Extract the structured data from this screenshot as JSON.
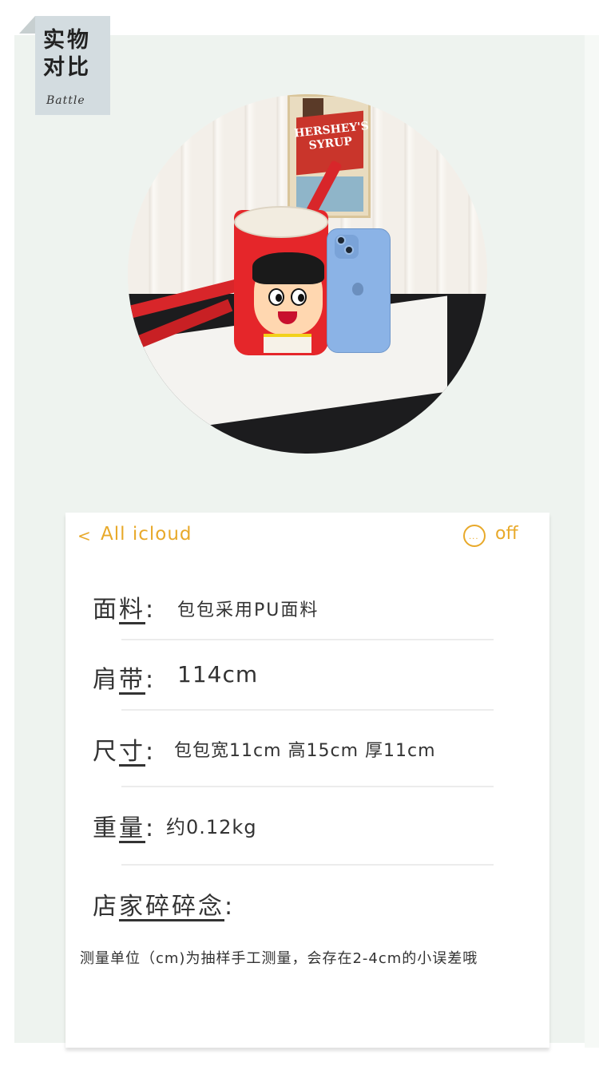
{
  "tag": {
    "title": "实物对比",
    "subtitle": "Battle"
  },
  "photo": {
    "poster_text": "HERSHEY'S SYRUP"
  },
  "card": {
    "nav": {
      "back": "<",
      "title": "All icloud",
      "more": "...",
      "status": "off"
    },
    "rows": [
      {
        "label_a": "面",
        "label_b": "料",
        "sep": ":",
        "value": "包包采用PU面料"
      },
      {
        "label_a": "肩",
        "label_b": "带",
        "sep": ":",
        "value": "114cm"
      },
      {
        "label_a": "尺",
        "label_b": "寸",
        "sep": ":",
        "value": "包包宽11cm 高15cm 厚11cm"
      },
      {
        "label_a": "重",
        "label_b": "量",
        "sep": ":",
        "value": "约0.12kg"
      },
      {
        "label_a": "店",
        "label_b": "家碎碎念",
        "sep": ":",
        "value": ""
      }
    ],
    "note": "测量单位（cm)为抽样手工测量，会存在2-4cm的小误差哦"
  },
  "colors": {
    "accent": "#e8a92a",
    "panel": "#eef3ef",
    "tag": "#d3dce0"
  }
}
